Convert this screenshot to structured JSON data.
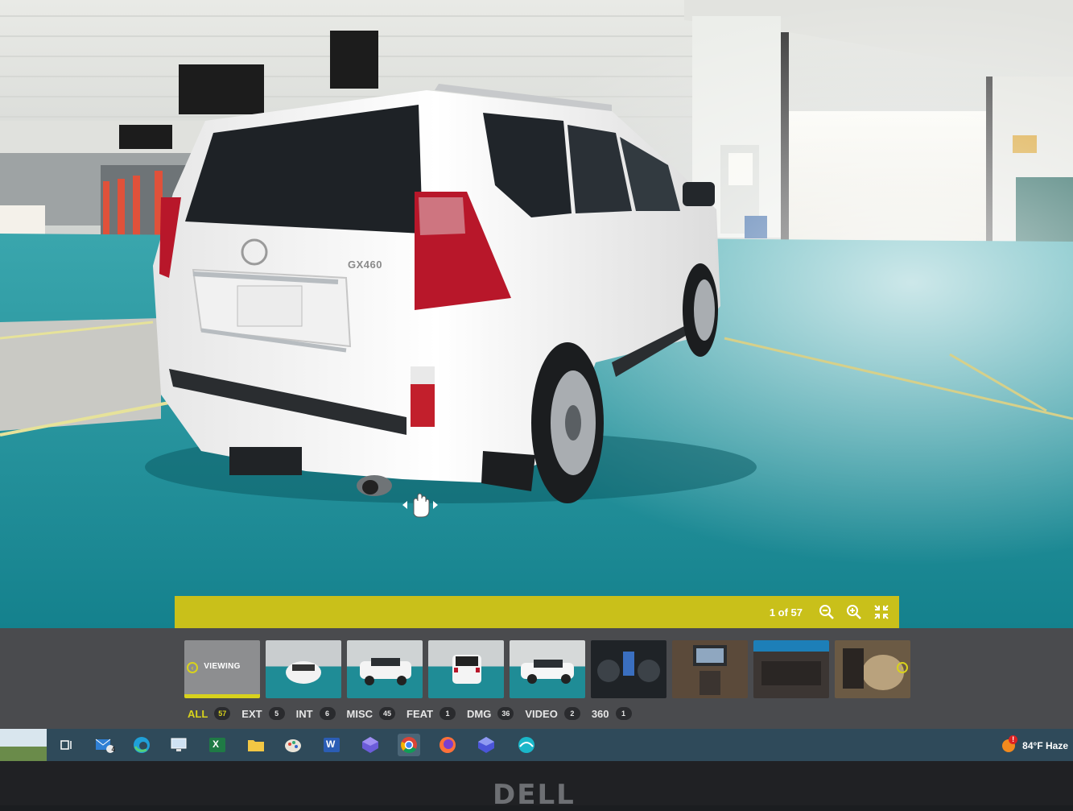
{
  "viewer": {
    "vehicle_badge": "GX460",
    "counter": "1 of 57",
    "zoom_out_icon": "zoom-out-icon",
    "zoom_in_icon": "zoom-in-icon",
    "fullscreen_icon": "collapse-icon",
    "pan_cursor_icon": "hand-drag-icon"
  },
  "gallery": {
    "active_label": "VIEWING",
    "thumbnails": [
      {
        "kind": "viewing"
      },
      {
        "kind": "exterior-front"
      },
      {
        "kind": "exterior-side"
      },
      {
        "kind": "exterior-rear"
      },
      {
        "kind": "exterior-side"
      },
      {
        "kind": "interior-dash"
      },
      {
        "kind": "interior-console"
      },
      {
        "kind": "interior-screen"
      },
      {
        "kind": "interior-seats"
      }
    ],
    "filters": [
      {
        "label": "ALL",
        "count": "57"
      },
      {
        "label": "EXT",
        "count": "5"
      },
      {
        "label": "INT",
        "count": "6"
      },
      {
        "label": "MISC",
        "count": "45"
      },
      {
        "label": "FEAT",
        "count": "1"
      },
      {
        "label": "DMG",
        "count": "36"
      },
      {
        "label": "VIDEO",
        "count": "2"
      },
      {
        "label": "360",
        "count": "1"
      }
    ]
  },
  "taskbar": {
    "mail_badge": "4",
    "excel_letter": "X",
    "word_letter": "W",
    "weather_text": "84°F  Haze",
    "weather_alert": "!"
  },
  "monitor": {
    "brand": "DELL"
  },
  "colors": {
    "accent": "#d8d21c",
    "floor": "#1f8c96",
    "taskbar": "#2f4a5a"
  }
}
